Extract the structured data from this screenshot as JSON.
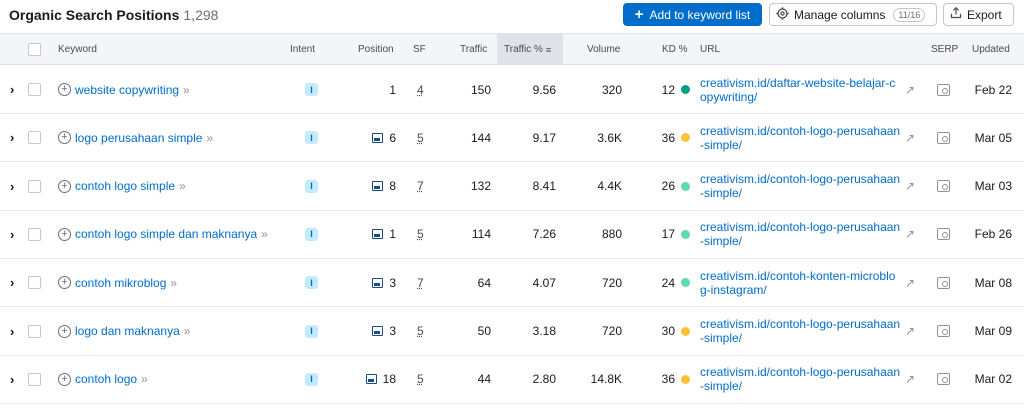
{
  "header": {
    "title": "Organic Search Positions",
    "count": "1,298",
    "add_button": "Add to keyword list",
    "columns_button": "Manage columns",
    "columns_badge": "11/16",
    "export_button": "Export"
  },
  "columns": {
    "keyword": "Keyword",
    "intent": "Intent",
    "position": "Position",
    "sf": "SF",
    "traffic": "Traffic",
    "traffic_pct": "Traffic %",
    "volume": "Volume",
    "kd": "KD %",
    "url": "URL",
    "serp": "SERP",
    "updated": "Updated"
  },
  "colors": {
    "kd_green_dark": "#009f81",
    "kd_green": "#59ddaa",
    "kd_yellow": "#fdc23c"
  },
  "rows": [
    {
      "keyword": "website copywriting",
      "intent": "I",
      "has_image": false,
      "position": "1",
      "sf": "4",
      "traffic": "150",
      "traffic_pct": "9.56",
      "volume": "320",
      "kd": "12",
      "kd_color": "#009f81",
      "url": "creativism.id/daftar-website-belajar-copywriting/",
      "updated": "Feb 22"
    },
    {
      "keyword": "logo perusahaan simple",
      "intent": "I",
      "has_image": true,
      "position": "6",
      "sf": "5",
      "traffic": "144",
      "traffic_pct": "9.17",
      "volume": "3.6K",
      "kd": "36",
      "kd_color": "#fdc23c",
      "url": "creativism.id/contoh-logo-perusahaan-simple/",
      "updated": "Mar 05"
    },
    {
      "keyword": "contoh logo simple",
      "intent": "I",
      "has_image": true,
      "position": "8",
      "sf": "7",
      "traffic": "132",
      "traffic_pct": "8.41",
      "volume": "4.4K",
      "kd": "26",
      "kd_color": "#59ddaa",
      "url": "creativism.id/contoh-logo-perusahaan-simple/",
      "updated": "Mar 03"
    },
    {
      "keyword": "contoh logo simple dan maknanya",
      "intent": "I",
      "has_image": true,
      "position": "1",
      "sf": "5",
      "traffic": "114",
      "traffic_pct": "7.26",
      "volume": "880",
      "kd": "17",
      "kd_color": "#59ddaa",
      "url": "creativism.id/contoh-logo-perusahaan-simple/",
      "updated": "Feb 26"
    },
    {
      "keyword": "contoh mikroblog",
      "intent": "I",
      "has_image": true,
      "position": "3",
      "sf": "7",
      "traffic": "64",
      "traffic_pct": "4.07",
      "volume": "720",
      "kd": "24",
      "kd_color": "#59ddaa",
      "url": "creativism.id/contoh-konten-microblog-instagram/",
      "updated": "Mar 08"
    },
    {
      "keyword": "logo dan maknanya",
      "intent": "I",
      "has_image": true,
      "position": "3",
      "sf": "5",
      "traffic": "50",
      "traffic_pct": "3.18",
      "volume": "720",
      "kd": "30",
      "kd_color": "#fdc23c",
      "url": "creativism.id/contoh-logo-perusahaan-simple/",
      "updated": "Mar 09"
    },
    {
      "keyword": "contoh logo",
      "intent": "I",
      "has_image": true,
      "position": "18",
      "sf": "5",
      "traffic": "44",
      "traffic_pct": "2.80",
      "volume": "14.8K",
      "kd": "36",
      "kd_color": "#fdc23c",
      "url": "creativism.id/contoh-logo-perusahaan-simple/",
      "updated": "Mar 02"
    }
  ]
}
